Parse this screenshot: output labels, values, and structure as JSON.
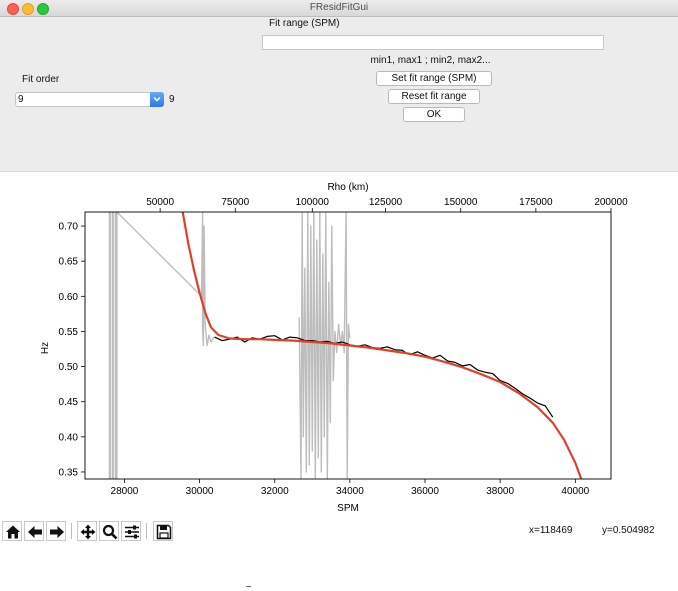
{
  "window": {
    "title": "FResidFitGui"
  },
  "fit_range": {
    "label": "Fit range (SPM)",
    "value": "",
    "hint": "min1, max1 ; min2, max2...",
    "set_button": "Set fit range (SPM)",
    "reset_button": "Reset fit range",
    "ok_button": "OK"
  },
  "fit_order": {
    "label": "Fit order",
    "selected": "9",
    "display_value": "9"
  },
  "toolbar": {
    "icons": [
      "home-icon",
      "back-arrow-icon",
      "forward-arrow-icon",
      "pan-icon",
      "zoom-icon",
      "configure-subplots-icon",
      "save-icon"
    ]
  },
  "status": {
    "x_readout": "x=118469",
    "y_readout": "y=0.504982"
  },
  "colors": {
    "data_line": "#000000",
    "masked_line": "#bdbdbd",
    "fit_line": "#e0402a"
  },
  "chart_data": {
    "type": "line",
    "xlabel": "SPM",
    "ylabel": "Hz",
    "top_xlabel": "Rho (km)",
    "xlim": [
      26950,
      40950
    ],
    "ylim": [
      0.34,
      0.72
    ],
    "xticks": [
      28000,
      30000,
      32000,
      34000,
      36000,
      38000,
      40000
    ],
    "xtick_labels": [
      "28000",
      "30000",
      "32000",
      "34000",
      "36000",
      "38000",
      "40000"
    ],
    "yticks": [
      0.35,
      0.4,
      0.45,
      0.5,
      0.55,
      0.6,
      0.65,
      0.7
    ],
    "ytick_labels": [
      "0.35",
      "0.40",
      "0.45",
      "0.50",
      "0.55",
      "0.60",
      "0.65",
      "0.70"
    ],
    "top_ticks": [
      {
        "spm": 28950,
        "label": "50000"
      },
      {
        "spm": 30950,
        "label": "75000"
      },
      {
        "spm": 33000,
        "label": "100000"
      },
      {
        "spm": 34950,
        "label": "125000"
      },
      {
        "spm": 36950,
        "label": "150000"
      },
      {
        "spm": 38950,
        "label": "175000"
      },
      {
        "spm": 40950,
        "label": "200000"
      }
    ],
    "series": [
      {
        "name": "",
        "role": "fit",
        "x": [
          29550,
          29700,
          29850,
          30000,
          30150,
          30300,
          30500,
          30800,
          31200,
          31600,
          32000,
          32500,
          33000,
          33500,
          34000,
          34500,
          35000,
          35500,
          36000,
          36500,
          37000,
          37500,
          38000,
          38500,
          39000,
          39400,
          39700,
          40000,
          40200
        ],
        "y": [
          0.72,
          0.675,
          0.637,
          0.605,
          0.577,
          0.556,
          0.545,
          0.54,
          0.539,
          0.539,
          0.538,
          0.537,
          0.535,
          0.533,
          0.53,
          0.527,
          0.523,
          0.519,
          0.514,
          0.507,
          0.499,
          0.489,
          0.478,
          0.462,
          0.442,
          0.42,
          0.396,
          0.363,
          0.334
        ]
      },
      {
        "name": "",
        "role": "data",
        "x": [
          30400,
          30600,
          30800,
          31000,
          31200,
          31400,
          31600,
          31800,
          32000,
          32200,
          32400,
          32600,
          32800,
          33000,
          33200,
          33400,
          33600,
          33800,
          34000,
          34200,
          34400,
          34600,
          34800,
          35000,
          35200,
          35400,
          35500,
          35600,
          35800,
          36000,
          36200,
          36400,
          36600,
          36800,
          37000,
          37200,
          37400,
          37600,
          37800,
          38000,
          38200,
          38400,
          38600,
          38800,
          39000,
          39200,
          39400
        ],
        "y": [
          0.542,
          0.537,
          0.539,
          0.542,
          0.535,
          0.541,
          0.539,
          0.543,
          0.544,
          0.538,
          0.542,
          0.541,
          0.537,
          0.537,
          0.535,
          0.536,
          0.533,
          0.535,
          0.531,
          0.529,
          0.531,
          0.527,
          0.526,
          0.528,
          0.524,
          0.523,
          0.519,
          0.517,
          0.521,
          0.516,
          0.512,
          0.516,
          0.508,
          0.506,
          0.501,
          0.503,
          0.495,
          0.492,
          0.49,
          0.48,
          0.476,
          0.469,
          0.461,
          0.455,
          0.448,
          0.444,
          0.428
        ]
      },
      {
        "name": "",
        "role": "masked",
        "x": [
          27600,
          27600,
          27620,
          27620,
          27680,
          27680,
          27700,
          27700,
          27760,
          27760,
          27780,
          27780,
          27800,
          27800,
          30050,
          30080,
          30080,
          30100,
          30120,
          30150,
          30200,
          30250,
          30300,
          30350,
          30400
        ],
        "y": [
          0.34,
          0.72,
          0.72,
          0.34,
          0.34,
          0.72,
          0.72,
          0.34,
          0.34,
          0.72,
          0.72,
          0.34,
          0.34,
          0.72,
          0.6,
          0.72,
          0.55,
          0.53,
          0.7,
          0.56,
          0.53,
          0.545,
          0.535,
          0.54,
          0.542
        ]
      },
      {
        "name": "",
        "role": "masked",
        "x": [
          32650,
          32700,
          32730,
          32760,
          32800,
          32840,
          32880,
          32920,
          32960,
          33000,
          33040,
          33080,
          33120,
          33160,
          33200,
          33240,
          33280,
          33320,
          33360,
          33400,
          33440,
          33480,
          33520,
          33560,
          33600,
          33650,
          33700,
          33750,
          33800,
          33850,
          33900,
          33930,
          33960,
          34000
        ],
        "y": [
          0.57,
          0.34,
          0.72,
          0.4,
          0.64,
          0.35,
          0.72,
          0.36,
          0.7,
          0.38,
          0.72,
          0.34,
          0.68,
          0.37,
          0.72,
          0.35,
          0.66,
          0.4,
          0.72,
          0.34,
          0.62,
          0.42,
          0.7,
          0.48,
          0.55,
          0.52,
          0.56,
          0.53,
          0.55,
          0.52,
          0.72,
          0.34,
          0.56,
          0.54
        ]
      }
    ]
  }
}
